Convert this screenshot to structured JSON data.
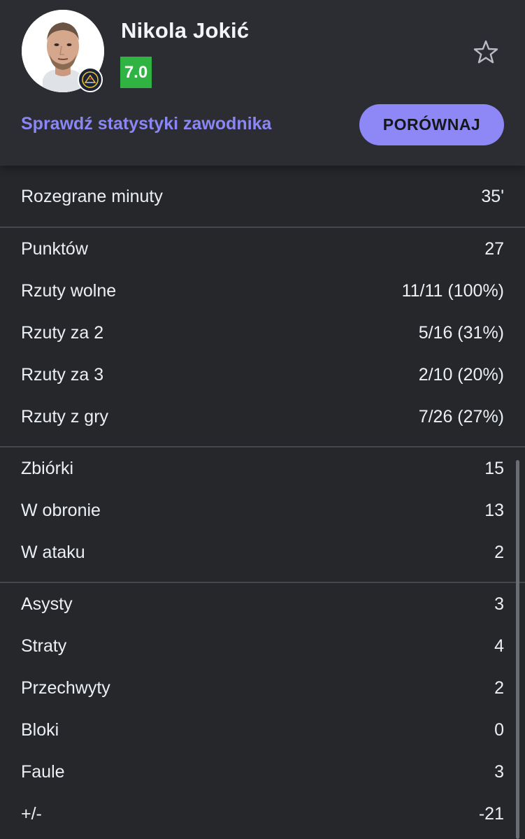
{
  "player": {
    "name": "Nikola Jokić",
    "rating": "7.0",
    "rating_color": "#2fb342"
  },
  "header": {
    "stats_link": "Sprawdź statystyki zawodnika",
    "compare_button": "PORÓWNAJ",
    "favorite_icon": "star-outline-icon",
    "team_icon": "denver-nuggets-logo-icon"
  },
  "colors": {
    "accent": "#8e88f7",
    "background": "#25272b",
    "header_bg": "#2b2d32"
  },
  "stats": {
    "minutes": [
      {
        "label": "Rozegrane minuty",
        "value": "35'"
      }
    ],
    "scoring": [
      {
        "label": "Punktów",
        "value": "27"
      },
      {
        "label": "Rzuty wolne",
        "value": "11/11 (100%)"
      },
      {
        "label": "Rzuty za 2",
        "value": "5/16 (31%)"
      },
      {
        "label": "Rzuty za 3",
        "value": "2/10 (20%)"
      },
      {
        "label": "Rzuty z gry",
        "value": "7/26 (27%)"
      }
    ],
    "rebounds": [
      {
        "label": "Zbiórki",
        "value": "15"
      },
      {
        "label": "W obronie",
        "value": "13"
      },
      {
        "label": "W ataku",
        "value": "2"
      }
    ],
    "other": [
      {
        "label": "Asysty",
        "value": "3"
      },
      {
        "label": "Straty",
        "value": "4"
      },
      {
        "label": "Przechwyty",
        "value": "2"
      },
      {
        "label": "Bloki",
        "value": "0"
      },
      {
        "label": "Faule",
        "value": "3"
      },
      {
        "label": "+/-",
        "value": "-21"
      }
    ]
  }
}
